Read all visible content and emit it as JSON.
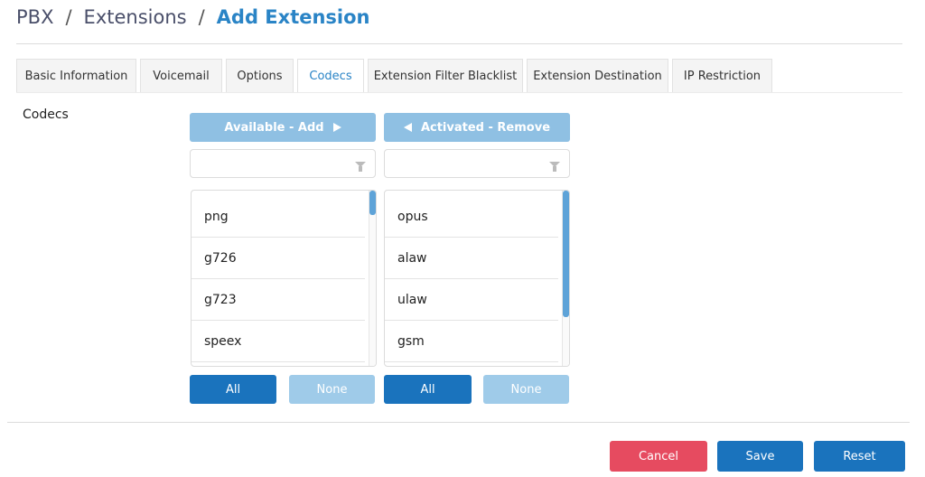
{
  "breadcrumb": {
    "items": [
      "PBX",
      "Extensions"
    ],
    "separator": "/",
    "current": "Add Extension"
  },
  "tabs": [
    {
      "label": "Basic Information",
      "active": false
    },
    {
      "label": "Voicemail",
      "active": false
    },
    {
      "label": "Options",
      "active": false
    },
    {
      "label": "Codecs",
      "active": true
    },
    {
      "label": "Extension Filter Blacklist",
      "active": false
    },
    {
      "label": "Extension Destination",
      "active": false
    },
    {
      "label": "IP Restriction",
      "active": false
    }
  ],
  "codecs": {
    "label": "Codecs",
    "available": {
      "button_label": "Available - Add",
      "filter_value": "",
      "items": [
        "png",
        "g726",
        "g723",
        "speex"
      ],
      "all_label": "All",
      "none_label": "None"
    },
    "activated": {
      "button_label": "Activated - Remove",
      "filter_value": "",
      "items": [
        "opus",
        "alaw",
        "ulaw",
        "gsm"
      ],
      "all_label": "All",
      "none_label": "None"
    }
  },
  "actions": {
    "cancel_label": "Cancel",
    "save_label": "Save",
    "reset_label": "Reset"
  },
  "colors": {
    "accent": "#2a84c6",
    "primary_button": "#1a73bd",
    "disabled_button": "#9fcbe9",
    "danger_button": "#e64b60"
  }
}
